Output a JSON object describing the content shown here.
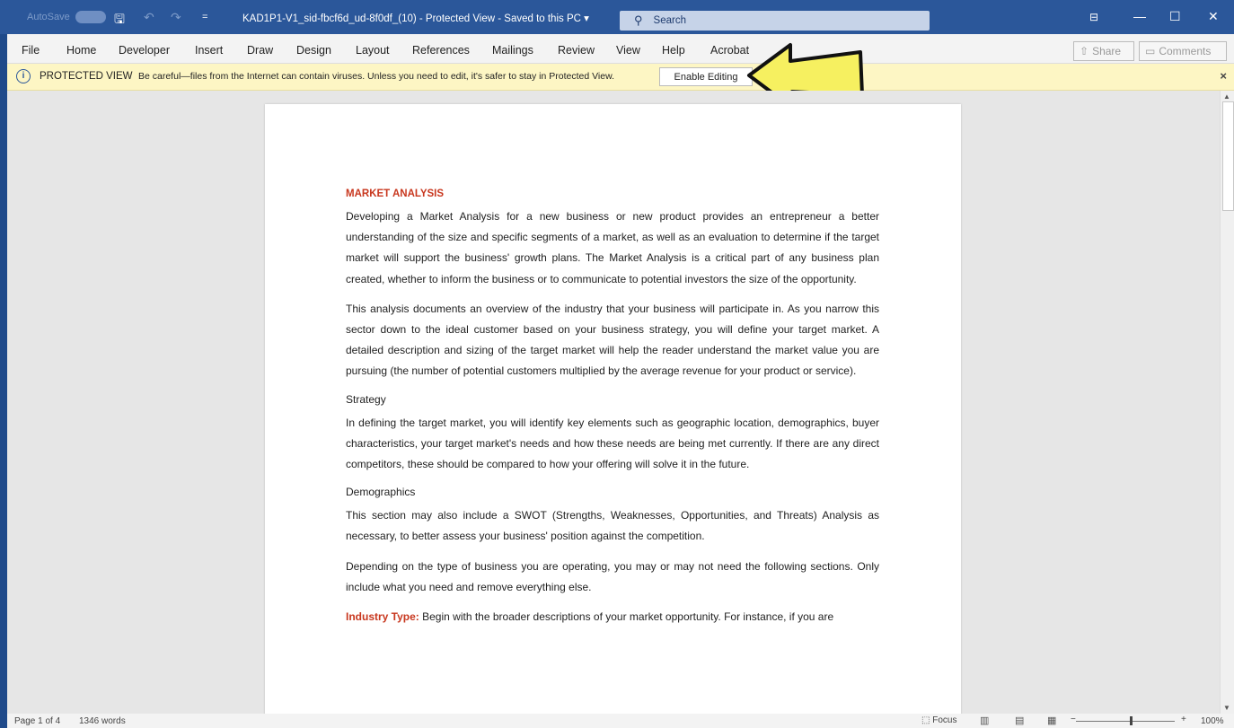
{
  "titlebar": {
    "autosave_label": "AutoSave",
    "toggle_state": "Off",
    "doc_title": "KAD1P1-V1_sid-fbcf6d_ud-8f0df_(10) - Protected View - Saved to this PC ▾",
    "search_placeholder": "Search",
    "icons": [
      "save-icon",
      "undo-icon",
      "redo-icon",
      "customize-qat-icon",
      "ribbon-display-icon",
      "minimize-icon",
      "maximize-icon",
      "close-icon"
    ]
  },
  "menu": {
    "items": [
      "File",
      "Home",
      "Developer",
      "Insert",
      "Draw",
      "Design",
      "Layout",
      "References",
      "Mailings",
      "Review",
      "View",
      "Help",
      "Acrobat"
    ],
    "share_label": "Share",
    "comments_label": "Comments"
  },
  "protected_view": {
    "label": "PROTECTED VIEW",
    "message": "Be careful—files from the Internet can contain viruses. Unless you need to edit, it's safer to stay in Protected View.",
    "button": "Enable Editing",
    "close": "×"
  },
  "document": {
    "heading": "MARKET ANALYSIS",
    "paragraphs": [
      "Developing a Market Analysis for a new business or new product provides an entrepreneur a better understanding of the size and specific segments of a market, as well as an evaluation to determine if the target market will support the business' growth plans. The Market Analysis is a critical part of any business plan created, whether to inform the business or to communicate to potential investors the size of the opportunity.",
      "This analysis documents an overview of the industry that your business will participate in. As you narrow this sector down to the ideal customer based on your business strategy, you will define your target market. A detailed description and sizing of the target market will help the reader understand the market value you are pursuing (the number of potential customers multiplied by the average revenue for your product or service)."
    ],
    "strategy_heading": "Strategy",
    "strategy_text": "In defining the target market, you will identify key elements such as geographic location, demographics, buyer characteristics, your target market's needs and how these needs are being met currently. If there are any direct competitors, these should be compared to how your offering will solve it in the future.",
    "demographics_heading": "Demographics",
    "demographics_text": "This section may also include a SWOT (Strengths, Weaknesses, Opportunities, and Threats) Analysis as necessary, to better assess your business' position against the competition.",
    "depending_text": "Depending on the type of business you are operating, you may or may not need the following sections. Only include what you need and remove everything else.",
    "industry_lead": "Industry Type:",
    "industry_text": " Begin with the broader descriptions of your market opportunity. For instance, if you are"
  },
  "status": {
    "page": "Page 1 of 4",
    "words": "1346 words",
    "focus": "Focus",
    "zoom": "100%",
    "zoom_minus": "−",
    "zoom_plus": "+"
  },
  "colors": {
    "titlebar": "#2b579a",
    "heading_red": "#c8371e",
    "protected_bar": "#fdf6c4",
    "arrow_fill": "#f6f060"
  }
}
